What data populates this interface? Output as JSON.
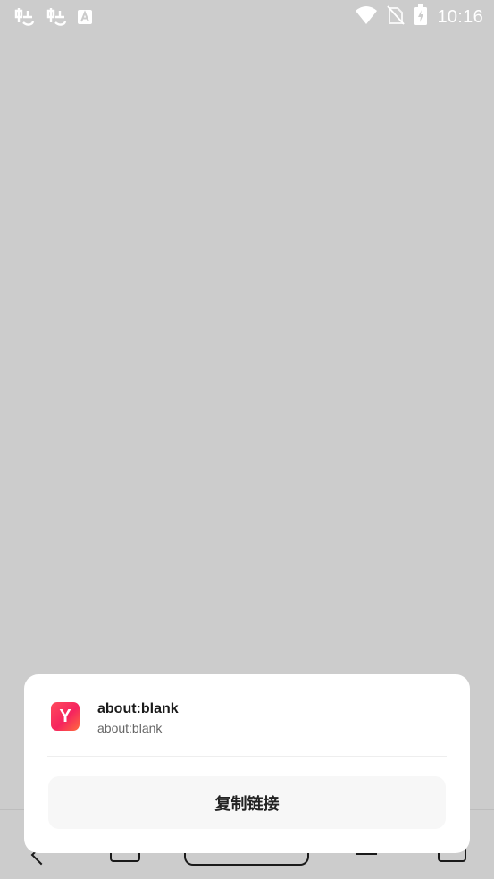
{
  "status_bar": {
    "time": "10:16",
    "left_icons": [
      "notification-bug-icon",
      "notification-bug-icon",
      "keyboard-a-icon"
    ],
    "right_icons": [
      "wifi-icon",
      "no-sim-icon",
      "battery-charging-icon"
    ]
  },
  "share_sheet": {
    "app_icon_letter": "Y",
    "title": "about:blank",
    "url": "about:blank",
    "copy_link_label": "复制链接"
  },
  "colors": {
    "background": "#cccccc",
    "sheet": "#ffffff",
    "button": "#f7f7f7",
    "app_icon": "#f5245f"
  }
}
